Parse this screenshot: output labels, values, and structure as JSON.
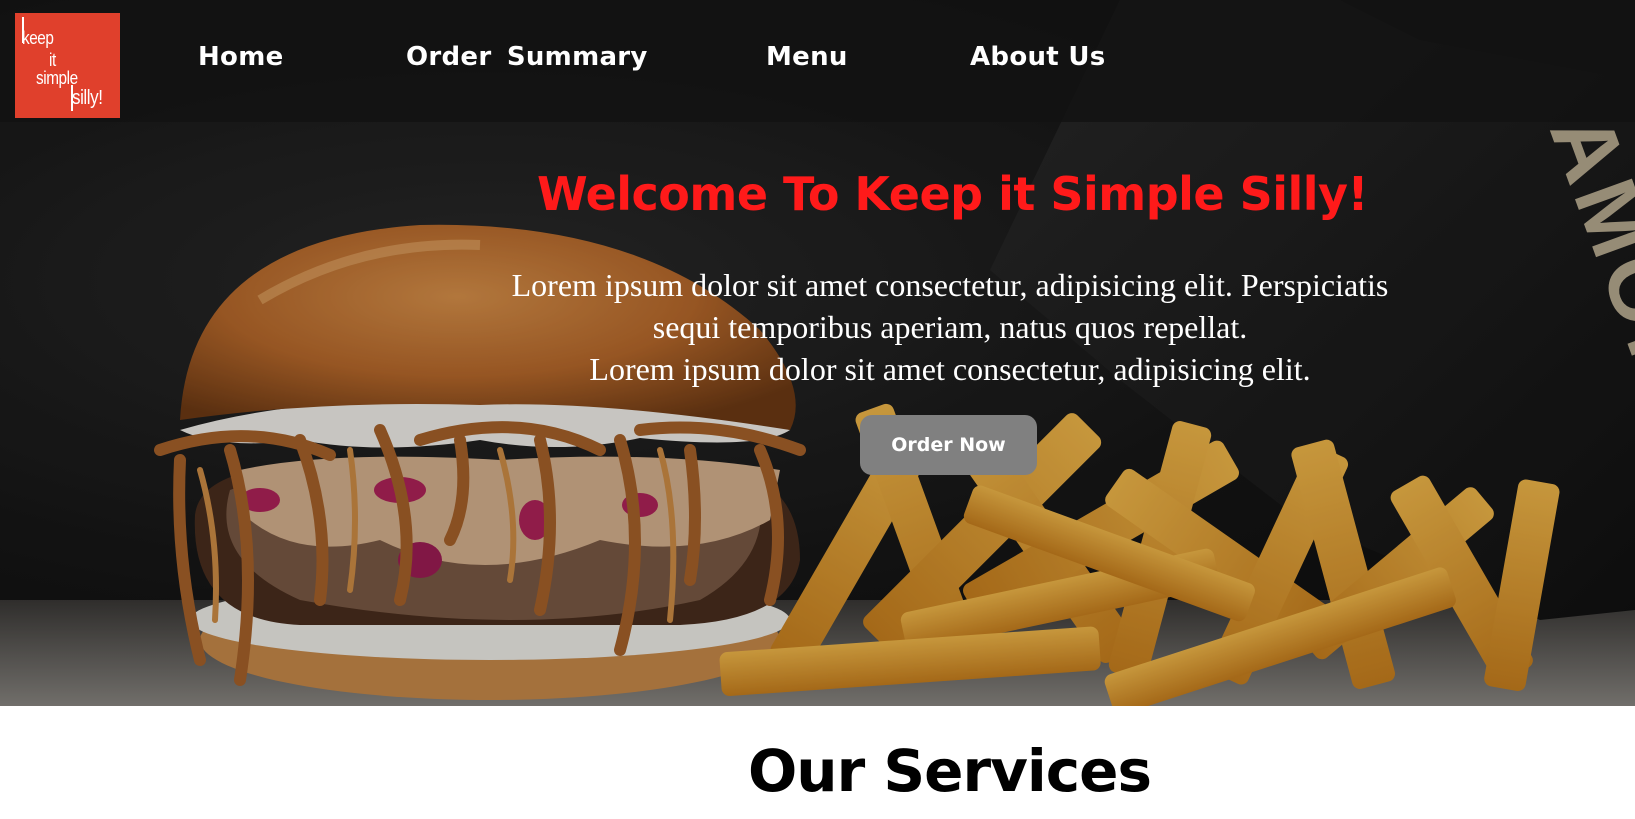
{
  "logo": {
    "line1": "keep",
    "line2": "it",
    "line3": "simple",
    "line4": "silly!"
  },
  "nav": {
    "home": "Home",
    "order_summary": "Order  Summary",
    "menu": "Menu",
    "about_us": "About Us"
  },
  "hero": {
    "title": "Welcome To Keep it Simple Silly!",
    "line1": "Lorem ipsum dolor sit amet consectetur, adipisicing elit. Perspiciatis",
    "line2": "sequi temporibus aperiam, natus quos repellat.",
    "line3": "Lorem ipsum dolor sit amet consectetur, adipisicing elit.",
    "button_label": "Order Now",
    "bag_text": "AMOR"
  },
  "services": {
    "title": "Our Services"
  },
  "colors": {
    "logo_bg": "#e0402c",
    "hero_title": "#ff1a1a",
    "button_bg": "#808080",
    "navbar_bg": "#121212"
  }
}
